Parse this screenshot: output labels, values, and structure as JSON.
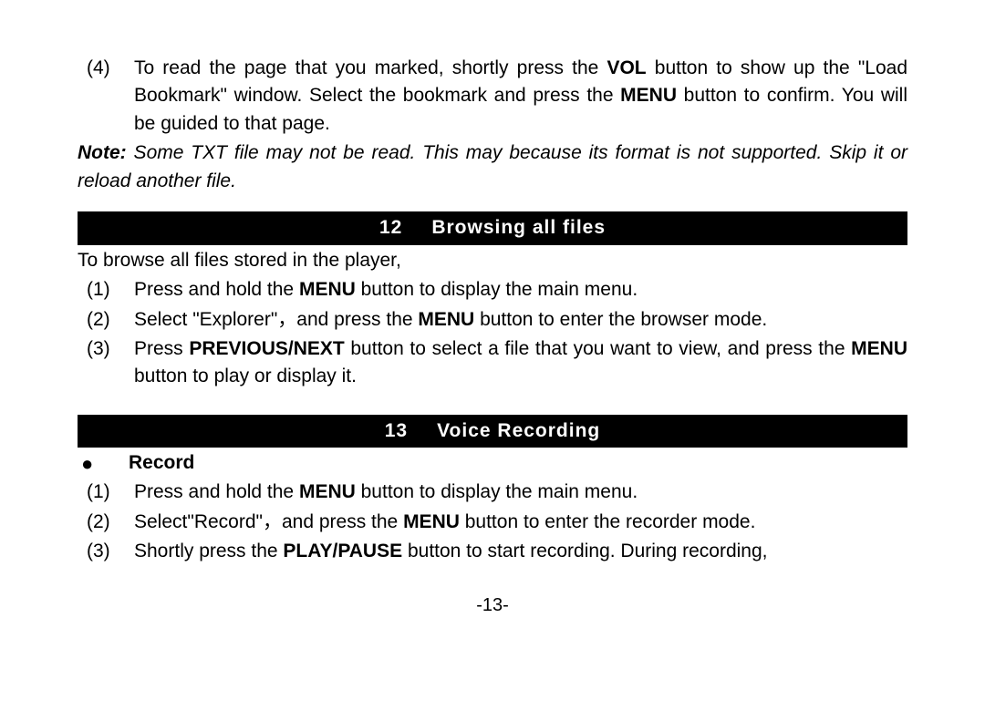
{
  "top_item": {
    "num": "(4)",
    "text_a": "To read the page that you marked, shortly press the ",
    "vol": "VOL",
    "text_b": " button to show up the \"Load Bookmark\" window. Select the bookmark and press the ",
    "menu": "MENU",
    "text_c": " button to confirm. You will be guided to that page."
  },
  "note": {
    "lead": "Note:",
    "body": " Some TXT file may not be read. This may because its format is not supported. Skip it or reload another file."
  },
  "section12": {
    "num": "12",
    "title": "Browsing all files",
    "intro": "To browse all files stored in the player,",
    "items": [
      {
        "num": "(1)",
        "a": "Press and hold the ",
        "b1": "MENU",
        "c": " button to display the main menu."
      },
      {
        "num": "(2)",
        "a": "Select \"Explorer\"，and press the ",
        "b1": "MENU",
        "c": " button to enter the browser mode."
      },
      {
        "num": "(3)",
        "a": "Press ",
        "b1": "PREVIOUS/NEXT",
        "c": " button to select a file that you want to view, and press the ",
        "b2": "MENU",
        "d": " button to play or display it."
      }
    ]
  },
  "section13": {
    "num": "13",
    "title": "Voice Recording",
    "sub": "Record",
    "items": [
      {
        "num": "(1)",
        "a": "Press and hold the ",
        "b1": "MENU",
        "c": " button to display the main menu."
      },
      {
        "num": "(2)",
        "a": "Select\"Record\"，and press the ",
        "b1": "MENU",
        "c": " button to enter the recorder mode."
      },
      {
        "num": "(3)",
        "a": "Shortly press the ",
        "b1": "PLAY/PAUSE",
        "c": " button to start recording. During recording,"
      }
    ]
  },
  "page_number": "-13-"
}
